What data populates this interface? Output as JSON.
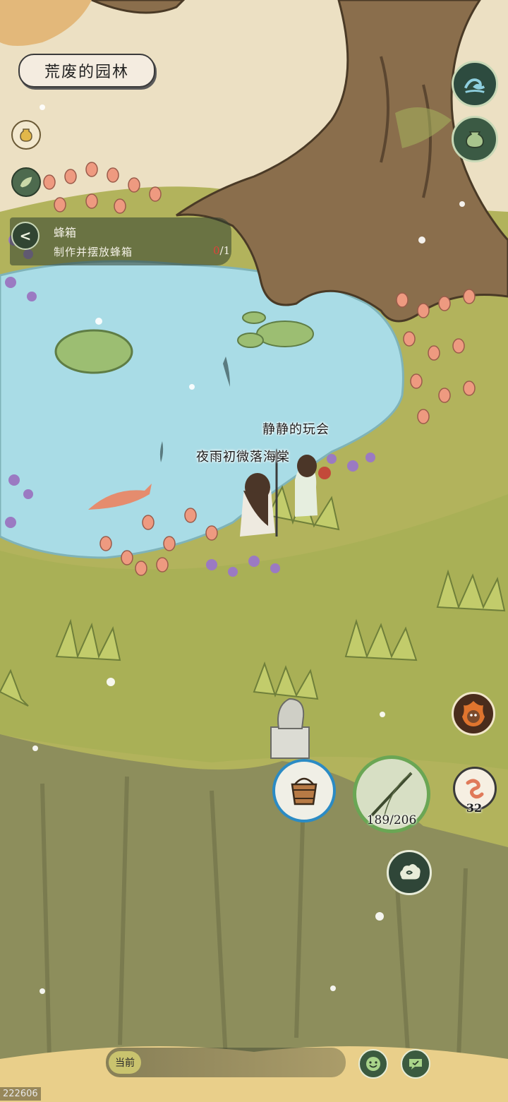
{
  "area": {
    "title": "荒废的园林"
  },
  "quest": {
    "title": "蜂箱",
    "description": "制作并摆放蜂箱",
    "progress_current": "0",
    "progress_total": "/1"
  },
  "players": [
    {
      "name": "静静的玩会"
    },
    {
      "name": "夜雨初微落海棠"
    }
  ],
  "tools": {
    "rod_durability": "189/206",
    "bait_count": "32"
  },
  "chat": {
    "channel_label": "当前"
  },
  "build": {
    "id": "222606"
  },
  "icons": {
    "jar": "jar-icon",
    "leaf": "leaf-icon",
    "back": "chevron-left-icon",
    "wave": "wave-icon",
    "pot": "pot-icon",
    "fire": "fire-spirit-icon",
    "bucket": "bucket-icon",
    "rod": "fishing-rod-icon",
    "worm": "worm-bait-icon",
    "cloud": "cloud-icon",
    "emoji": "emoji-icon",
    "message": "message-icon"
  },
  "colors": {
    "grass": "#a8b35a",
    "pond": "#a8dbe4",
    "cliff": "#8e8f5e",
    "accent_progress": "#e0413a"
  }
}
